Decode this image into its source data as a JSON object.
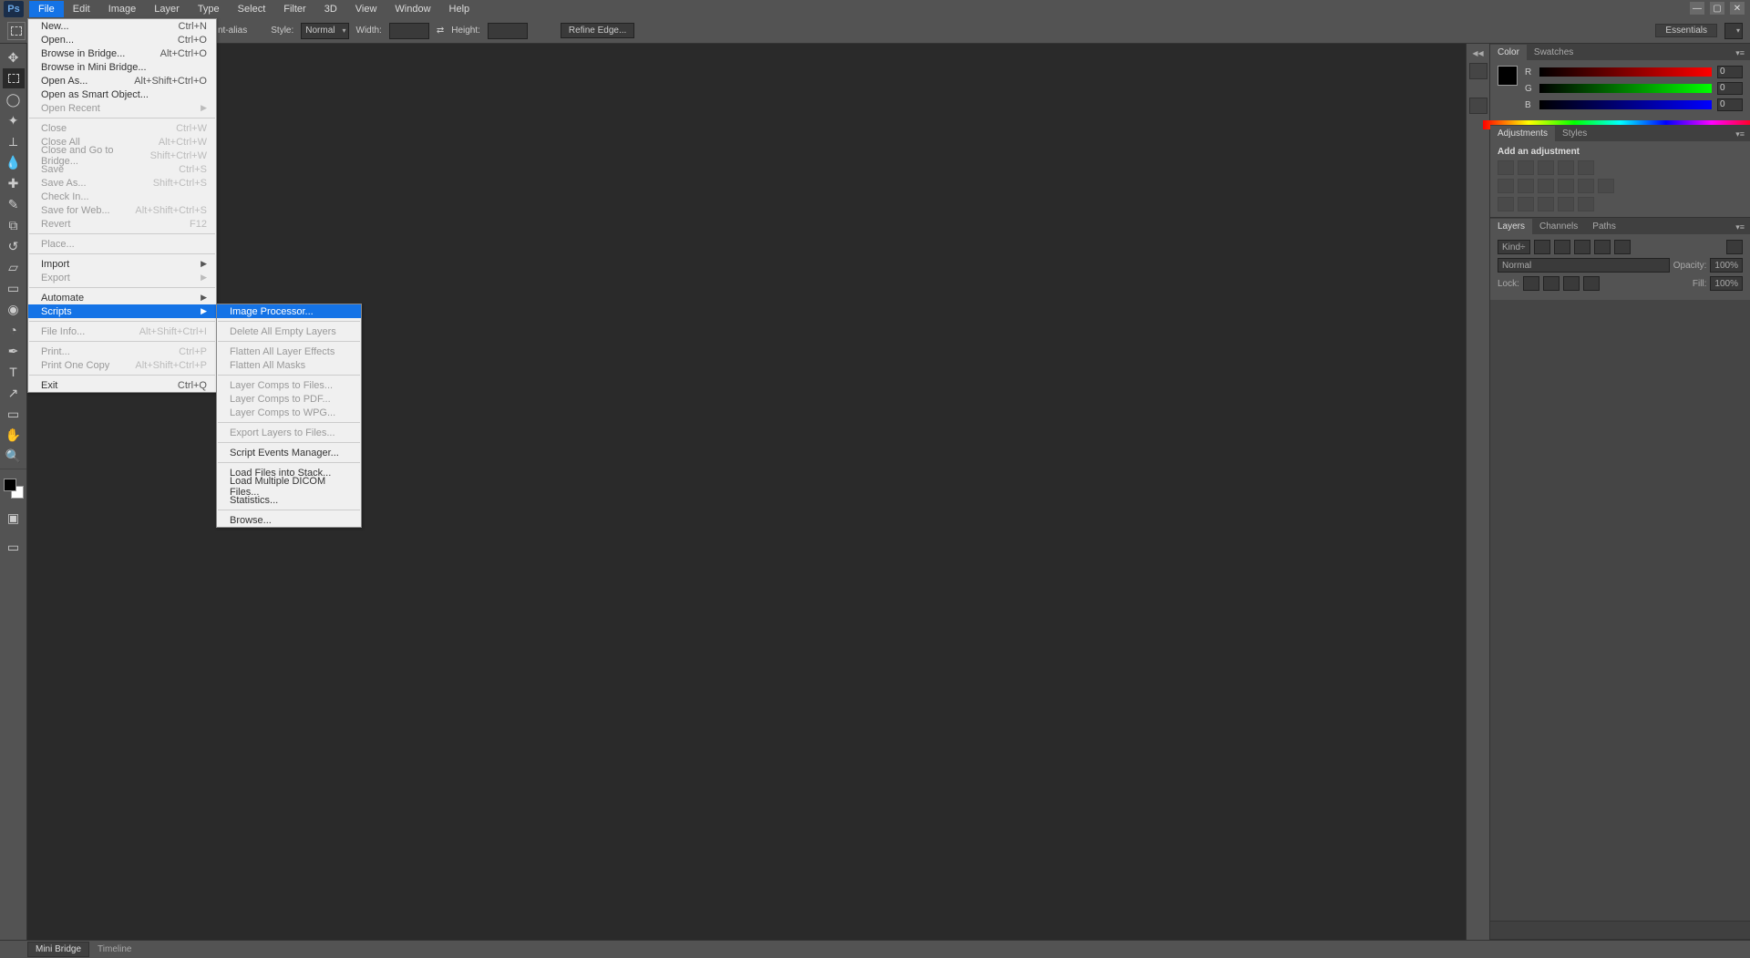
{
  "menubar": [
    "File",
    "Edit",
    "Image",
    "Layer",
    "Type",
    "Select",
    "Filter",
    "3D",
    "View",
    "Window",
    "Help"
  ],
  "active_menu_index": 0,
  "optionsbar": {
    "antialias": "nt-alias",
    "style_label": "Style:",
    "style_value": "Normal",
    "width_label": "Width:",
    "height_label": "Height:",
    "refine": "Refine Edge...",
    "workspace": "Essentials"
  },
  "file_menu": [
    {
      "type": "item",
      "label": "New...",
      "shortcut": "Ctrl+N"
    },
    {
      "type": "item",
      "label": "Open...",
      "shortcut": "Ctrl+O"
    },
    {
      "type": "item",
      "label": "Browse in Bridge...",
      "shortcut": "Alt+Ctrl+O"
    },
    {
      "type": "item",
      "label": "Browse in Mini Bridge..."
    },
    {
      "type": "item",
      "label": "Open As...",
      "shortcut": "Alt+Shift+Ctrl+O"
    },
    {
      "type": "item",
      "label": "Open as Smart Object..."
    },
    {
      "type": "item",
      "label": "Open Recent",
      "submenu": true,
      "disabled": true
    },
    {
      "type": "sep"
    },
    {
      "type": "item",
      "label": "Close",
      "shortcut": "Ctrl+W",
      "disabled": true
    },
    {
      "type": "item",
      "label": "Close All",
      "shortcut": "Alt+Ctrl+W",
      "disabled": true
    },
    {
      "type": "item",
      "label": "Close and Go to Bridge...",
      "shortcut": "Shift+Ctrl+W",
      "disabled": true
    },
    {
      "type": "item",
      "label": "Save",
      "shortcut": "Ctrl+S",
      "disabled": true
    },
    {
      "type": "item",
      "label": "Save As...",
      "shortcut": "Shift+Ctrl+S",
      "disabled": true
    },
    {
      "type": "item",
      "label": "Check In...",
      "disabled": true
    },
    {
      "type": "item",
      "label": "Save for Web...",
      "shortcut": "Alt+Shift+Ctrl+S",
      "disabled": true
    },
    {
      "type": "item",
      "label": "Revert",
      "shortcut": "F12",
      "disabled": true
    },
    {
      "type": "sep"
    },
    {
      "type": "item",
      "label": "Place...",
      "disabled": true
    },
    {
      "type": "sep"
    },
    {
      "type": "item",
      "label": "Import",
      "submenu": true
    },
    {
      "type": "item",
      "label": "Export",
      "submenu": true,
      "disabled": true
    },
    {
      "type": "sep"
    },
    {
      "type": "item",
      "label": "Automate",
      "submenu": true
    },
    {
      "type": "item",
      "label": "Scripts",
      "submenu": true,
      "highlight": true
    },
    {
      "type": "sep"
    },
    {
      "type": "item",
      "label": "File Info...",
      "shortcut": "Alt+Shift+Ctrl+I",
      "disabled": true
    },
    {
      "type": "sep"
    },
    {
      "type": "item",
      "label": "Print...",
      "shortcut": "Ctrl+P",
      "disabled": true
    },
    {
      "type": "item",
      "label": "Print One Copy",
      "shortcut": "Alt+Shift+Ctrl+P",
      "disabled": true
    },
    {
      "type": "sep"
    },
    {
      "type": "item",
      "label": "Exit",
      "shortcut": "Ctrl+Q"
    }
  ],
  "scripts_menu": [
    {
      "type": "item",
      "label": "Image Processor...",
      "highlight": true
    },
    {
      "type": "sep"
    },
    {
      "type": "item",
      "label": "Delete All Empty Layers",
      "disabled": true
    },
    {
      "type": "sep"
    },
    {
      "type": "item",
      "label": "Flatten All Layer Effects",
      "disabled": true
    },
    {
      "type": "item",
      "label": "Flatten All Masks",
      "disabled": true
    },
    {
      "type": "sep"
    },
    {
      "type": "item",
      "label": "Layer Comps to Files...",
      "disabled": true
    },
    {
      "type": "item",
      "label": "Layer Comps to PDF...",
      "disabled": true
    },
    {
      "type": "item",
      "label": "Layer Comps to WPG...",
      "disabled": true
    },
    {
      "type": "sep"
    },
    {
      "type": "item",
      "label": "Export Layers to Files...",
      "disabled": true
    },
    {
      "type": "sep"
    },
    {
      "type": "item",
      "label": "Script Events Manager..."
    },
    {
      "type": "sep"
    },
    {
      "type": "item",
      "label": "Load Files into Stack..."
    },
    {
      "type": "item",
      "label": "Load Multiple DICOM Files..."
    },
    {
      "type": "item",
      "label": "Statistics..."
    },
    {
      "type": "sep"
    },
    {
      "type": "item",
      "label": "Browse..."
    }
  ],
  "panels": {
    "color_tabs": [
      "Color",
      "Swatches"
    ],
    "adjustments_tabs": [
      "Adjustments",
      "Styles"
    ],
    "add_adjustment_label": "Add an adjustment",
    "layers_tabs": [
      "Layers",
      "Channels",
      "Paths"
    ],
    "kind_label": "Kind",
    "blend_mode": "Normal",
    "opacity_label": "Opacity:",
    "opacity_value": "100%",
    "lock_label": "Lock:",
    "fill_label": "Fill:",
    "fill_value": "100%",
    "rgb": {
      "r": "0",
      "g": "0",
      "b": "0"
    }
  },
  "statusbar": {
    "tab1": "Mini Bridge",
    "tab2": "Timeline"
  }
}
